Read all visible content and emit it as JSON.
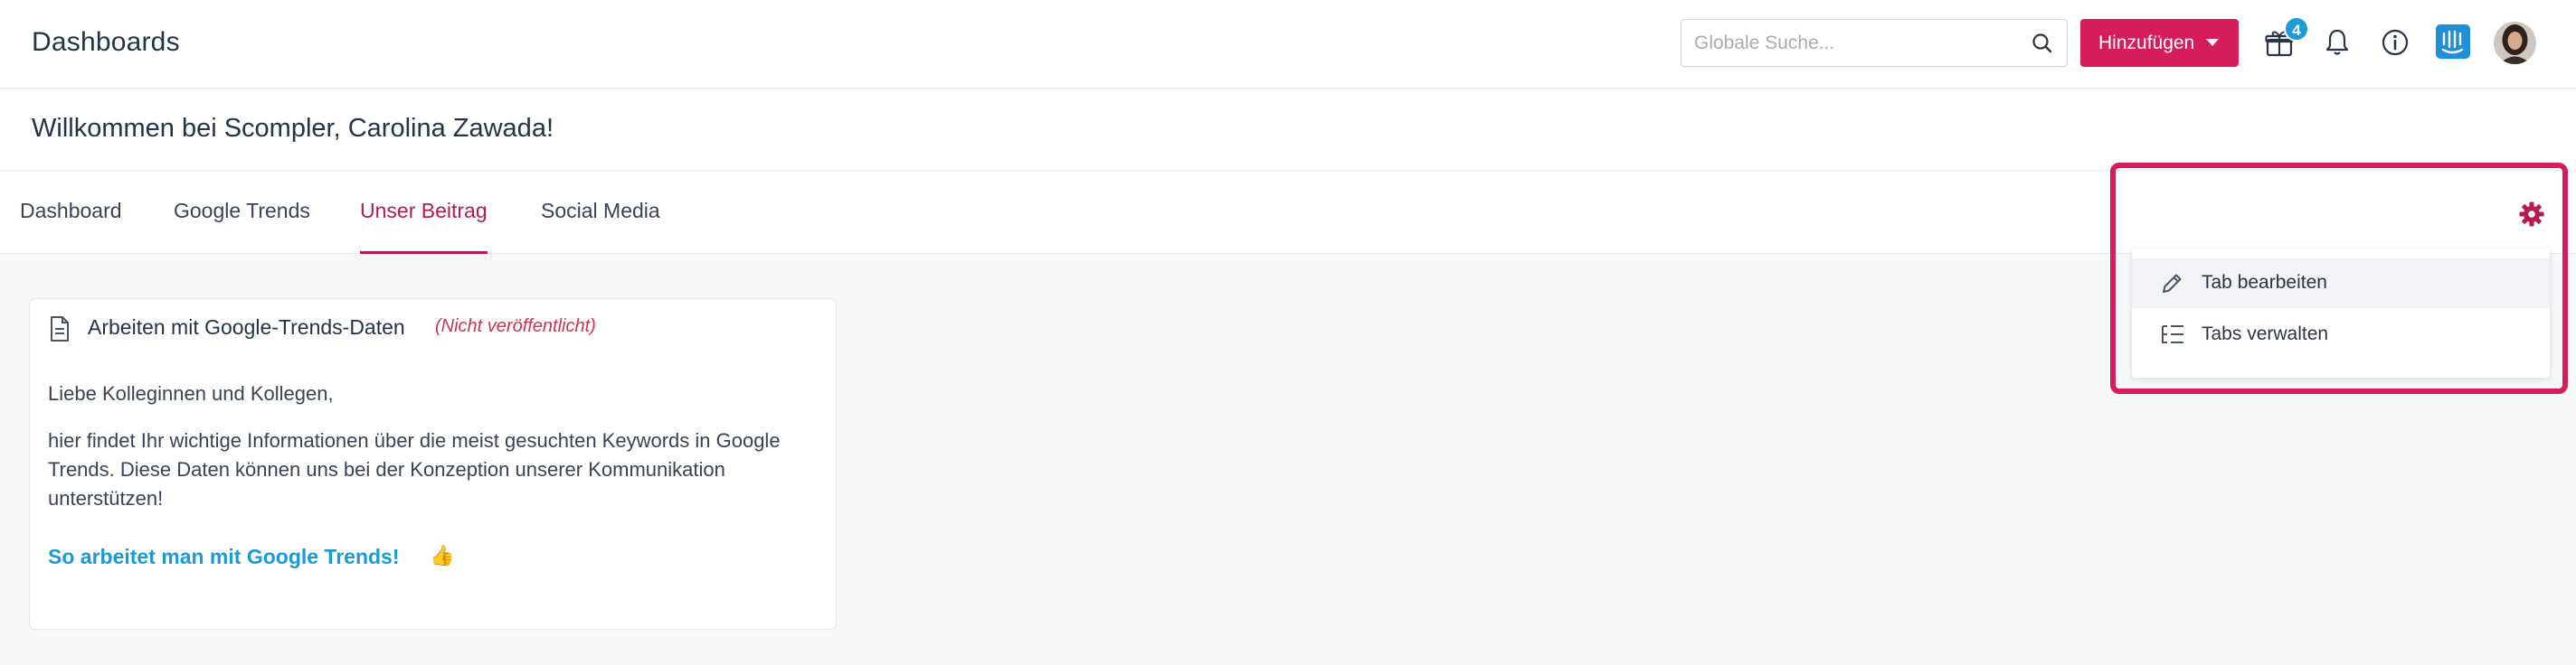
{
  "header": {
    "title": "Dashboards",
    "search_placeholder": "Globale Suche...",
    "add_button_label": "Hinzufügen",
    "gift_badge_count": "4"
  },
  "welcome": {
    "text": "Willkommen bei Scompler, Carolina Zawada!"
  },
  "tabs": [
    {
      "label": "Dashboard",
      "active": false
    },
    {
      "label": "Google Trends",
      "active": false
    },
    {
      "label": "Unser Beitrag",
      "active": true
    },
    {
      "label": "Social Media",
      "active": false
    }
  ],
  "post": {
    "title": "Arbeiten mit Google-Trends-Daten",
    "status": "(Nicht veröffentlicht)",
    "greeting": "Liebe Kolleginnen und Kollegen,",
    "body": "hier findet Ihr wichtige Informationen über die meist gesuchten Keywords in Google Trends. Diese Daten können uns bei der Konzeption unserer Kommunikation unterstützen!",
    "link_text": "So arbeitet man mit Google Trends!",
    "link_emoji": "👍"
  },
  "settings_menu": {
    "items": [
      {
        "label": "Tab bearbeiten",
        "icon": "pencil-icon"
      },
      {
        "label": "Tabs verwalten",
        "icon": "tree-list-icon"
      }
    ]
  },
  "colors": {
    "brand": "#d41d5a",
    "active_tab": "#b51b4d",
    "link": "#1a9bd4",
    "badge": "#1d9bd9"
  }
}
